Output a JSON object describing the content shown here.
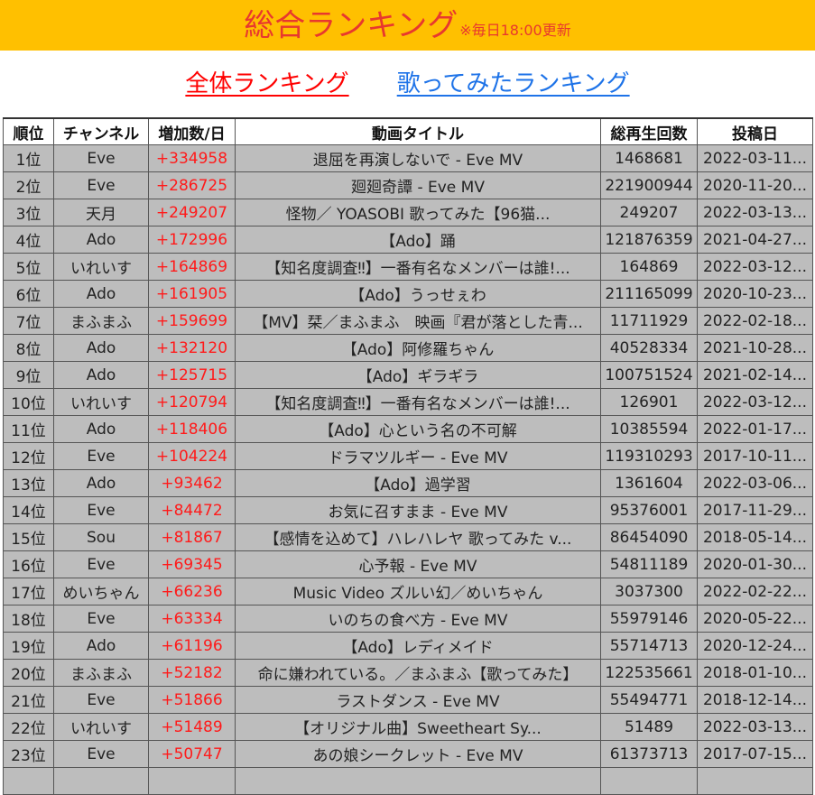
{
  "header": {
    "title": "総合ランキング",
    "note": "※毎日18:00更新",
    "bg_color": "#FFC000",
    "text_color": "#E8382E"
  },
  "nav": {
    "all_ranking": "全体ランキング",
    "utattemita_ranking": "歌ってみたランキング",
    "active_color": "#FF0000",
    "link_color": "#1E73E8"
  },
  "table": {
    "columns": [
      "順位",
      "チャンネル",
      "増加数/日",
      "動画タイトル",
      "総再生回数",
      "投稿日"
    ],
    "rows": [
      {
        "rank": "1位",
        "channel": "Eve",
        "increase": "+334958",
        "title": "退屈を再演しないで - Eve MV",
        "views": "1468681",
        "date": "2022-03-11..."
      },
      {
        "rank": "2位",
        "channel": "Eve",
        "increase": "+286725",
        "title": "廻廻奇譚 - Eve MV",
        "views": "221900944",
        "date": "2020-11-20..."
      },
      {
        "rank": "3位",
        "channel": "天月",
        "increase": "+249207",
        "title": "怪物／ YOASOBI 歌ってみた【96猫...",
        "views": "249207",
        "date": "2022-03-13..."
      },
      {
        "rank": "4位",
        "channel": "Ado",
        "increase": "+172996",
        "title": "【Ado】踊",
        "views": "121876359",
        "date": "2021-04-27..."
      },
      {
        "rank": "5位",
        "channel": "いれいす",
        "increase": "+164869",
        "title": "【知名度調査‼】一番有名なメンバーは誰!...",
        "views": "164869",
        "date": "2022-03-12..."
      },
      {
        "rank": "6位",
        "channel": "Ado",
        "increase": "+161905",
        "title": "【Ado】うっせぇわ",
        "views": "211165099",
        "date": "2020-10-23..."
      },
      {
        "rank": "7位",
        "channel": "まふまふ",
        "increase": "+159699",
        "title": "【MV】栞／まふまふ　映画『君が落とした青...",
        "views": "11711929",
        "date": "2022-02-18..."
      },
      {
        "rank": "8位",
        "channel": "Ado",
        "increase": "+132120",
        "title": "【Ado】阿修羅ちゃん",
        "views": "40528334",
        "date": "2021-10-28..."
      },
      {
        "rank": "9位",
        "channel": "Ado",
        "increase": "+125715",
        "title": "【Ado】ギラギラ",
        "views": "100751524",
        "date": "2021-02-14..."
      },
      {
        "rank": "10位",
        "channel": "いれいす",
        "increase": "+120794",
        "title": "【知名度調査‼】一番有名なメンバーは誰!...",
        "views": "126901",
        "date": "2022-03-12..."
      },
      {
        "rank": "11位",
        "channel": "Ado",
        "increase": "+118406",
        "title": "【Ado】心という名の不可解",
        "views": "10385594",
        "date": "2022-01-17..."
      },
      {
        "rank": "12位",
        "channel": "Eve",
        "increase": "+104224",
        "title": "ドラマツルギー - Eve MV",
        "views": "119310293",
        "date": "2017-10-11..."
      },
      {
        "rank": "13位",
        "channel": "Ado",
        "increase": "+93462",
        "title": "【Ado】過学習",
        "views": "1361604",
        "date": "2022-03-06..."
      },
      {
        "rank": "14位",
        "channel": "Eve",
        "increase": "+84472",
        "title": "お気に召すまま - Eve MV",
        "views": "95376001",
        "date": "2017-11-29..."
      },
      {
        "rank": "15位",
        "channel": "Sou",
        "increase": "+81867",
        "title": "【感情を込めて】ハレハレヤ 歌ってみた v...",
        "views": "86454090",
        "date": "2018-05-14..."
      },
      {
        "rank": "16位",
        "channel": "Eve",
        "increase": "+69345",
        "title": "心予報 - Eve MV",
        "views": "54811189",
        "date": "2020-01-30..."
      },
      {
        "rank": "17位",
        "channel": "めいちゃん",
        "increase": "+66236",
        "title": "Music Video ズルい幻／めいちゃん",
        "views": "3037300",
        "date": "2022-02-22..."
      },
      {
        "rank": "18位",
        "channel": "Eve",
        "increase": "+63334",
        "title": "いのちの食べ方 - Eve MV",
        "views": "55979146",
        "date": "2020-05-22..."
      },
      {
        "rank": "19位",
        "channel": "Ado",
        "increase": "+61196",
        "title": "【Ado】レディメイド",
        "views": "55714713",
        "date": "2020-12-24..."
      },
      {
        "rank": "20位",
        "channel": "まふまふ",
        "increase": "+52182",
        "title": "命に嫌われている。／まふまふ【歌ってみた】",
        "views": "122535661",
        "date": "2018-01-10..."
      },
      {
        "rank": "21位",
        "channel": "Eve",
        "increase": "+51866",
        "title": "ラストダンス - Eve MV",
        "views": "55494771",
        "date": "2018-12-14..."
      },
      {
        "rank": "22位",
        "channel": "いれいす",
        "increase": "+51489",
        "title": "【オリジナル曲】Sweetheart Sy...",
        "views": "51489",
        "date": "2022-03-13..."
      },
      {
        "rank": "23位",
        "channel": "Eve",
        "increase": "+50747",
        "title": "あの娘シークレット - Eve MV",
        "views": "61373713",
        "date": "2017-07-15..."
      },
      {
        "rank": "",
        "channel": "",
        "increase": "",
        "title": "",
        "views": "",
        "date": ""
      }
    ]
  }
}
